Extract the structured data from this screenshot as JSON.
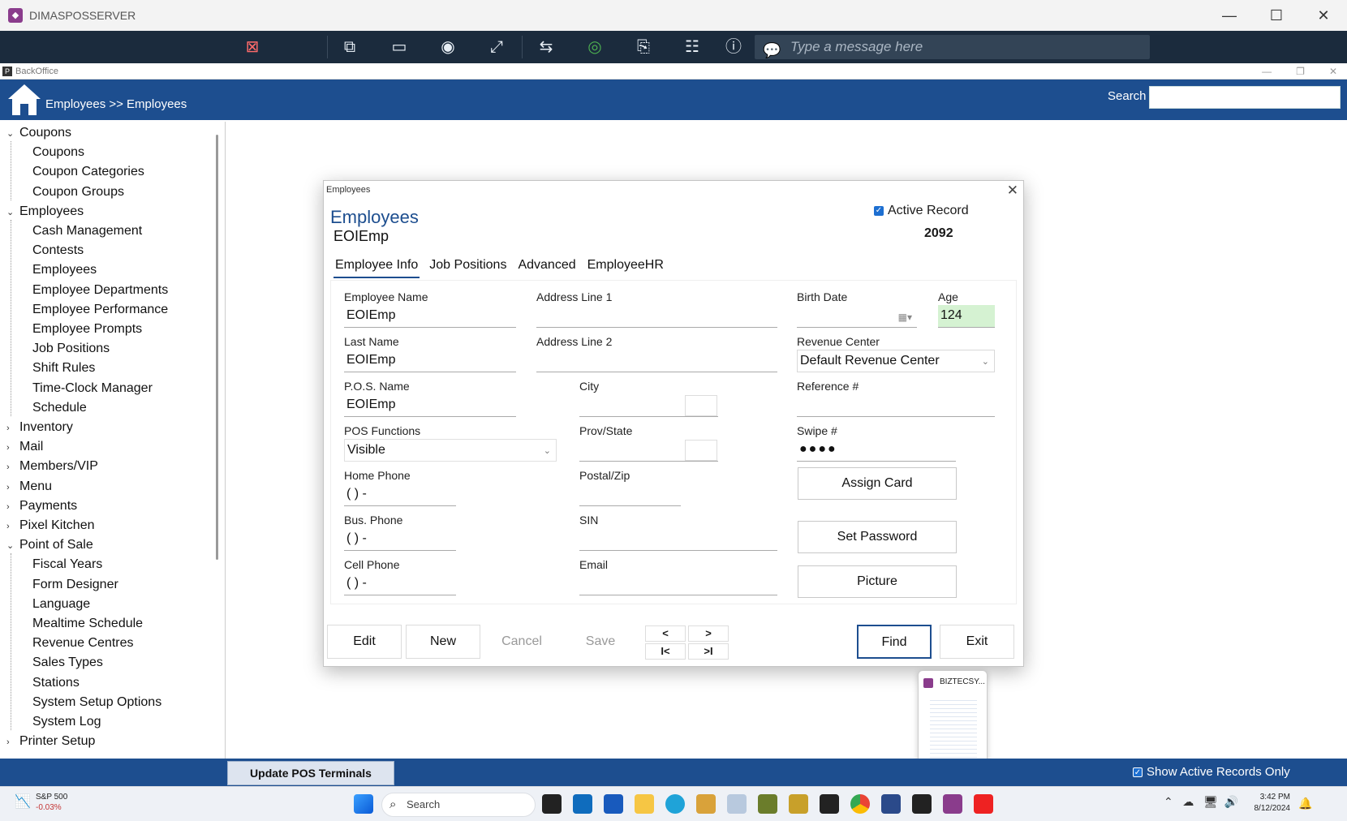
{
  "window": {
    "title": "DIMASPOSSERVER",
    "controls": [
      "—",
      "☐",
      "✕"
    ]
  },
  "remote_toolbar": {
    "icons": [
      "disconnect-icon",
      "remote-monitor-icon",
      "monitor-one-icon",
      "view-icon",
      "fullscreen-icon",
      "file-transfer-icon",
      "record-icon",
      "clipboard-icon",
      "settings-sliders-icon",
      "info-icon"
    ],
    "message_placeholder": "Type a message here"
  },
  "backoffice": {
    "title": "BackOffice"
  },
  "header": {
    "breadcrumb": "Employees >> Employees",
    "search_label": "Search",
    "search_value": ""
  },
  "sidebar": {
    "items": [
      {
        "label": "Coupons",
        "level": 0,
        "expanded": true
      },
      {
        "label": "Coupons",
        "level": 1
      },
      {
        "label": "Coupon Categories",
        "level": 1
      },
      {
        "label": "Coupon Groups",
        "level": 1
      },
      {
        "label": "Employees",
        "level": 0,
        "expanded": true
      },
      {
        "label": "Cash Management",
        "level": 1
      },
      {
        "label": "Contests",
        "level": 1
      },
      {
        "label": "Employees",
        "level": 1
      },
      {
        "label": "Employee Departments",
        "level": 1
      },
      {
        "label": "Employee Performance",
        "level": 1
      },
      {
        "label": "Employee Prompts",
        "level": 1
      },
      {
        "label": "Job Positions",
        "level": 1
      },
      {
        "label": "Shift Rules",
        "level": 1
      },
      {
        "label": "Time-Clock Manager",
        "level": 1
      },
      {
        "label": "Schedule",
        "level": 1
      },
      {
        "label": "Inventory",
        "level": 0,
        "expanded": false
      },
      {
        "label": "Mail",
        "level": 0,
        "expanded": false
      },
      {
        "label": "Members/VIP",
        "level": 0,
        "expanded": false
      },
      {
        "label": "Menu",
        "level": 0,
        "expanded": false
      },
      {
        "label": "Payments",
        "level": 0,
        "expanded": false
      },
      {
        "label": "Pixel Kitchen",
        "level": 0,
        "expanded": false
      },
      {
        "label": "Point of Sale",
        "level": 0,
        "expanded": true
      },
      {
        "label": "Fiscal Years",
        "level": 1
      },
      {
        "label": "Form Designer",
        "level": 1
      },
      {
        "label": "Language",
        "level": 1
      },
      {
        "label": "Mealtime Schedule",
        "level": 1
      },
      {
        "label": "Revenue Centres",
        "level": 1
      },
      {
        "label": "Sales Types",
        "level": 1
      },
      {
        "label": "Stations",
        "level": 1
      },
      {
        "label": "System Setup Options",
        "level": 1
      },
      {
        "label": "System Log",
        "level": 1
      },
      {
        "label": "Printer Setup",
        "level": 0,
        "expanded": false
      }
    ]
  },
  "dialog": {
    "window_title": "Employees",
    "heading": "Employees",
    "subheading": "EOIEmp",
    "active_record_label": "Active Record",
    "active_record_checked": true,
    "record_number": "2092",
    "tabs": [
      "Employee Info",
      "Job Positions",
      "Advanced",
      "EmployeeHR"
    ],
    "active_tab": "Employee Info",
    "fields": {
      "employee_name": {
        "label": "Employee Name",
        "value": "EOIEmp"
      },
      "last_name": {
        "label": "Last Name",
        "value": "EOIEmp"
      },
      "pos_name": {
        "label": "P.O.S. Name",
        "value": "EOIEmp"
      },
      "pos_functions": {
        "label": "POS Functions",
        "value": "Visible"
      },
      "home_phone": {
        "label": "Home Phone",
        "value": "(   )   -"
      },
      "bus_phone": {
        "label": "Bus. Phone",
        "value": "(   )   -"
      },
      "cell_phone": {
        "label": "Cell Phone",
        "value": "(   )   -"
      },
      "address_line1": {
        "label": "Address Line 1",
        "value": ""
      },
      "address_line2": {
        "label": "Address Line 2",
        "value": ""
      },
      "city": {
        "label": "City",
        "value": ""
      },
      "prov_state": {
        "label": "Prov/State",
        "value": ""
      },
      "postal_zip": {
        "label": "Postal/Zip",
        "value": ""
      },
      "sin": {
        "label": "SIN",
        "value": ""
      },
      "email": {
        "label": "Email",
        "value": ""
      },
      "birth_date": {
        "label": "Birth Date",
        "value": ""
      },
      "age": {
        "label": "Age",
        "value": "124"
      },
      "revenue_center": {
        "label": "Revenue Center",
        "value": "Default Revenue Center"
      },
      "reference": {
        "label": "Reference #",
        "value": ""
      },
      "swipe": {
        "label": "Swipe #",
        "value": "●●●●"
      }
    },
    "side_buttons": {
      "assign_card": "Assign Card",
      "set_password": "Set Password",
      "picture": "Picture"
    },
    "bottom_buttons": {
      "edit": "Edit",
      "new": "New",
      "cancel": "Cancel",
      "save": "Save",
      "find": "Find",
      "exit": "Exit"
    },
    "nav_buttons": {
      "prev": "<",
      "next": ">",
      "first": "I<",
      "last": ">I"
    }
  },
  "bottom_bar": {
    "update_button": "Update POS Terminals",
    "show_active_label": "Show Active Records Only",
    "show_active_checked": true
  },
  "thumbnail": {
    "title": "BIZTECSY..."
  },
  "taskbar": {
    "stock_name": "S&P 500",
    "stock_change": "-0.03%",
    "search_placeholder": "Search",
    "time": "3:42 PM",
    "date": "8/12/2024",
    "apps": [
      "start-icon",
      "search-icon",
      "pos-app-icon",
      "outlook-icon",
      "word-icon",
      "file-explorer-icon",
      "edge-icon",
      "app-icon",
      "app-icon",
      "app-icon",
      "app-icon",
      "pos-app-icon",
      "chrome-icon",
      "app-icon",
      "pos-app-icon",
      "dimas-icon",
      "red-cross-icon"
    ]
  },
  "colors": {
    "header_blue": "#1d4e8f",
    "toolbar_dark": "#1b2b3d",
    "age_field_green": "#d5f2d2",
    "accent_checkbox": "#1d6fd1"
  }
}
